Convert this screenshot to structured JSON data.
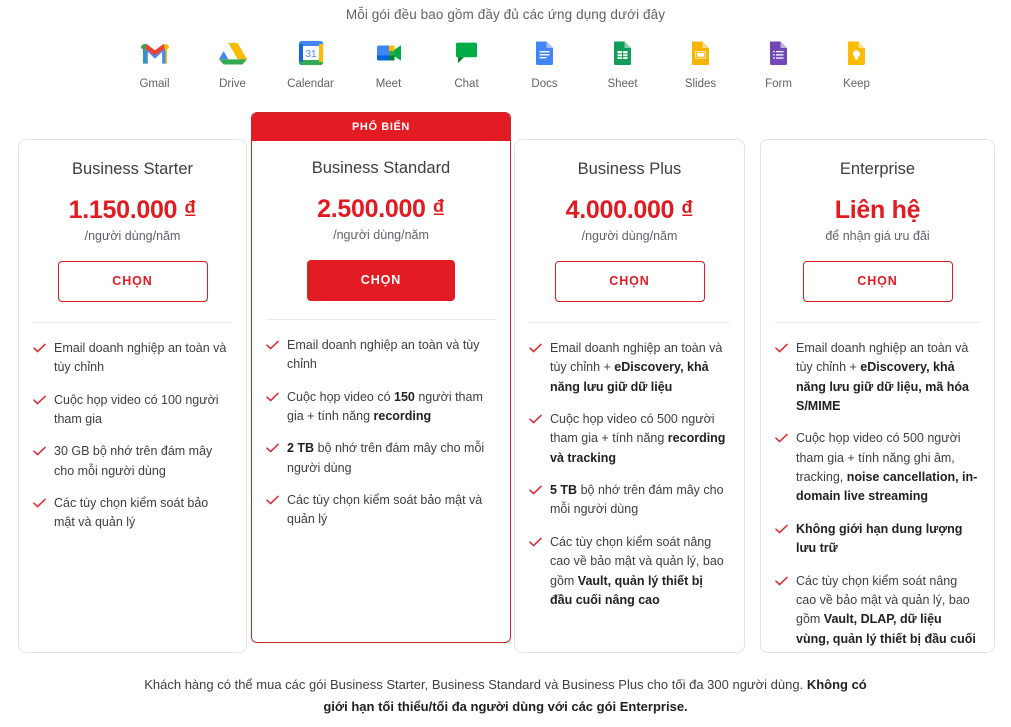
{
  "intro": "Mỗi gói đều bao gồm đầy đủ các ứng dụng dưới đây",
  "colors": {
    "brand_red": "#e31b23",
    "price_red": "#e01b22",
    "check_red": "#d8303a",
    "text": "#3c4043",
    "muted": "#5f6368"
  },
  "apps": [
    {
      "label": "Gmail",
      "icon": "gmail-icon"
    },
    {
      "label": "Drive",
      "icon": "drive-icon"
    },
    {
      "label": "Calendar",
      "icon": "calendar-icon"
    },
    {
      "label": "Meet",
      "icon": "meet-icon"
    },
    {
      "label": "Chat",
      "icon": "chat-icon"
    },
    {
      "label": "Docs",
      "icon": "docs-icon"
    },
    {
      "label": "Sheet",
      "icon": "sheets-icon"
    },
    {
      "label": "Slides",
      "icon": "slides-icon"
    },
    {
      "label": "Form",
      "icon": "forms-icon"
    },
    {
      "label": "Keep",
      "icon": "keep-icon"
    }
  ],
  "ribbon_label": "PHỔ BIẾN",
  "plans": [
    {
      "name": "Business Starter",
      "price": "1.150.000 ₫",
      "period": "/người dùng/năm",
      "cta": "CHỌN",
      "featured": false,
      "features": [
        "Email doanh nghiệp an toàn và tùy chỉnh",
        "Cuộc họp video có 100 người tham gia",
        "30 GB bộ nhớ trên đám mây cho mỗi người dùng",
        "Các tùy chọn kiểm soát bảo mật và quản lý"
      ]
    },
    {
      "name": "Business Standard",
      "price": "2.500.000 ₫",
      "period": "/người dùng/năm",
      "cta": "CHỌN",
      "featured": true,
      "features": [
        "Email doanh nghiệp an toàn và tùy chỉnh",
        "Cuộc họp video có <b>150</b> người tham gia + tính năng <b>recording</b>",
        "<b>2 TB</b> bộ nhớ trên đám mây cho mỗi người dùng",
        "Các tùy chọn kiểm soát bảo mật và quản lý"
      ]
    },
    {
      "name": "Business Plus",
      "price": "4.000.000 ₫",
      "period": "/người dùng/năm",
      "cta": "CHỌN",
      "featured": false,
      "features": [
        "Email doanh nghiệp an toàn và tùy chỉnh + <b>eDiscovery, khả năng lưu giữ dữ liệu</b>",
        "Cuộc họp video có 500 người tham gia + tính năng <b>recording và tracking</b>",
        "<b>5 TB</b> bộ nhớ trên đám mây cho mỗi người dùng",
        "Các tùy chọn kiểm soát nâng cao về bảo mật và quản lý, bao gồm <b>Vault, quản lý thiết bị đầu cuối nâng cao</b>"
      ]
    },
    {
      "name": "Enterprise",
      "price": "Liên hệ",
      "period": "để nhận giá ưu đãi",
      "cta": "CHỌN",
      "featured": false,
      "features": [
        "Email doanh nghiệp an toàn và tùy chỉnh + <b>eDiscovery, khả năng lưu giữ dữ liệu, mã hóa S/MIME</b>",
        "Cuộc họp video có 500 người tham gia + tính năng ghi âm, tracking, <b>noise cancellation, in-domain live streaming</b>",
        "<b>Không giới hạn dung lượng lưu trữ</b>",
        "Các tùy chọn kiểm soát nâng cao về bảo mật và quản lý, bao gồm <b>Vault, DLAP, dữ liệu vùng, quản lý thiết bị đầu cuối nâng cao</b>"
      ]
    }
  ],
  "footer": "Khách hàng có thể mua các gói Business Starter, Business Standard và Business Plus cho tối đa 300 người dùng. <b>Không có giới hạn tối thiểu/tối đa người dùng với các gói Enterprise.</b>"
}
